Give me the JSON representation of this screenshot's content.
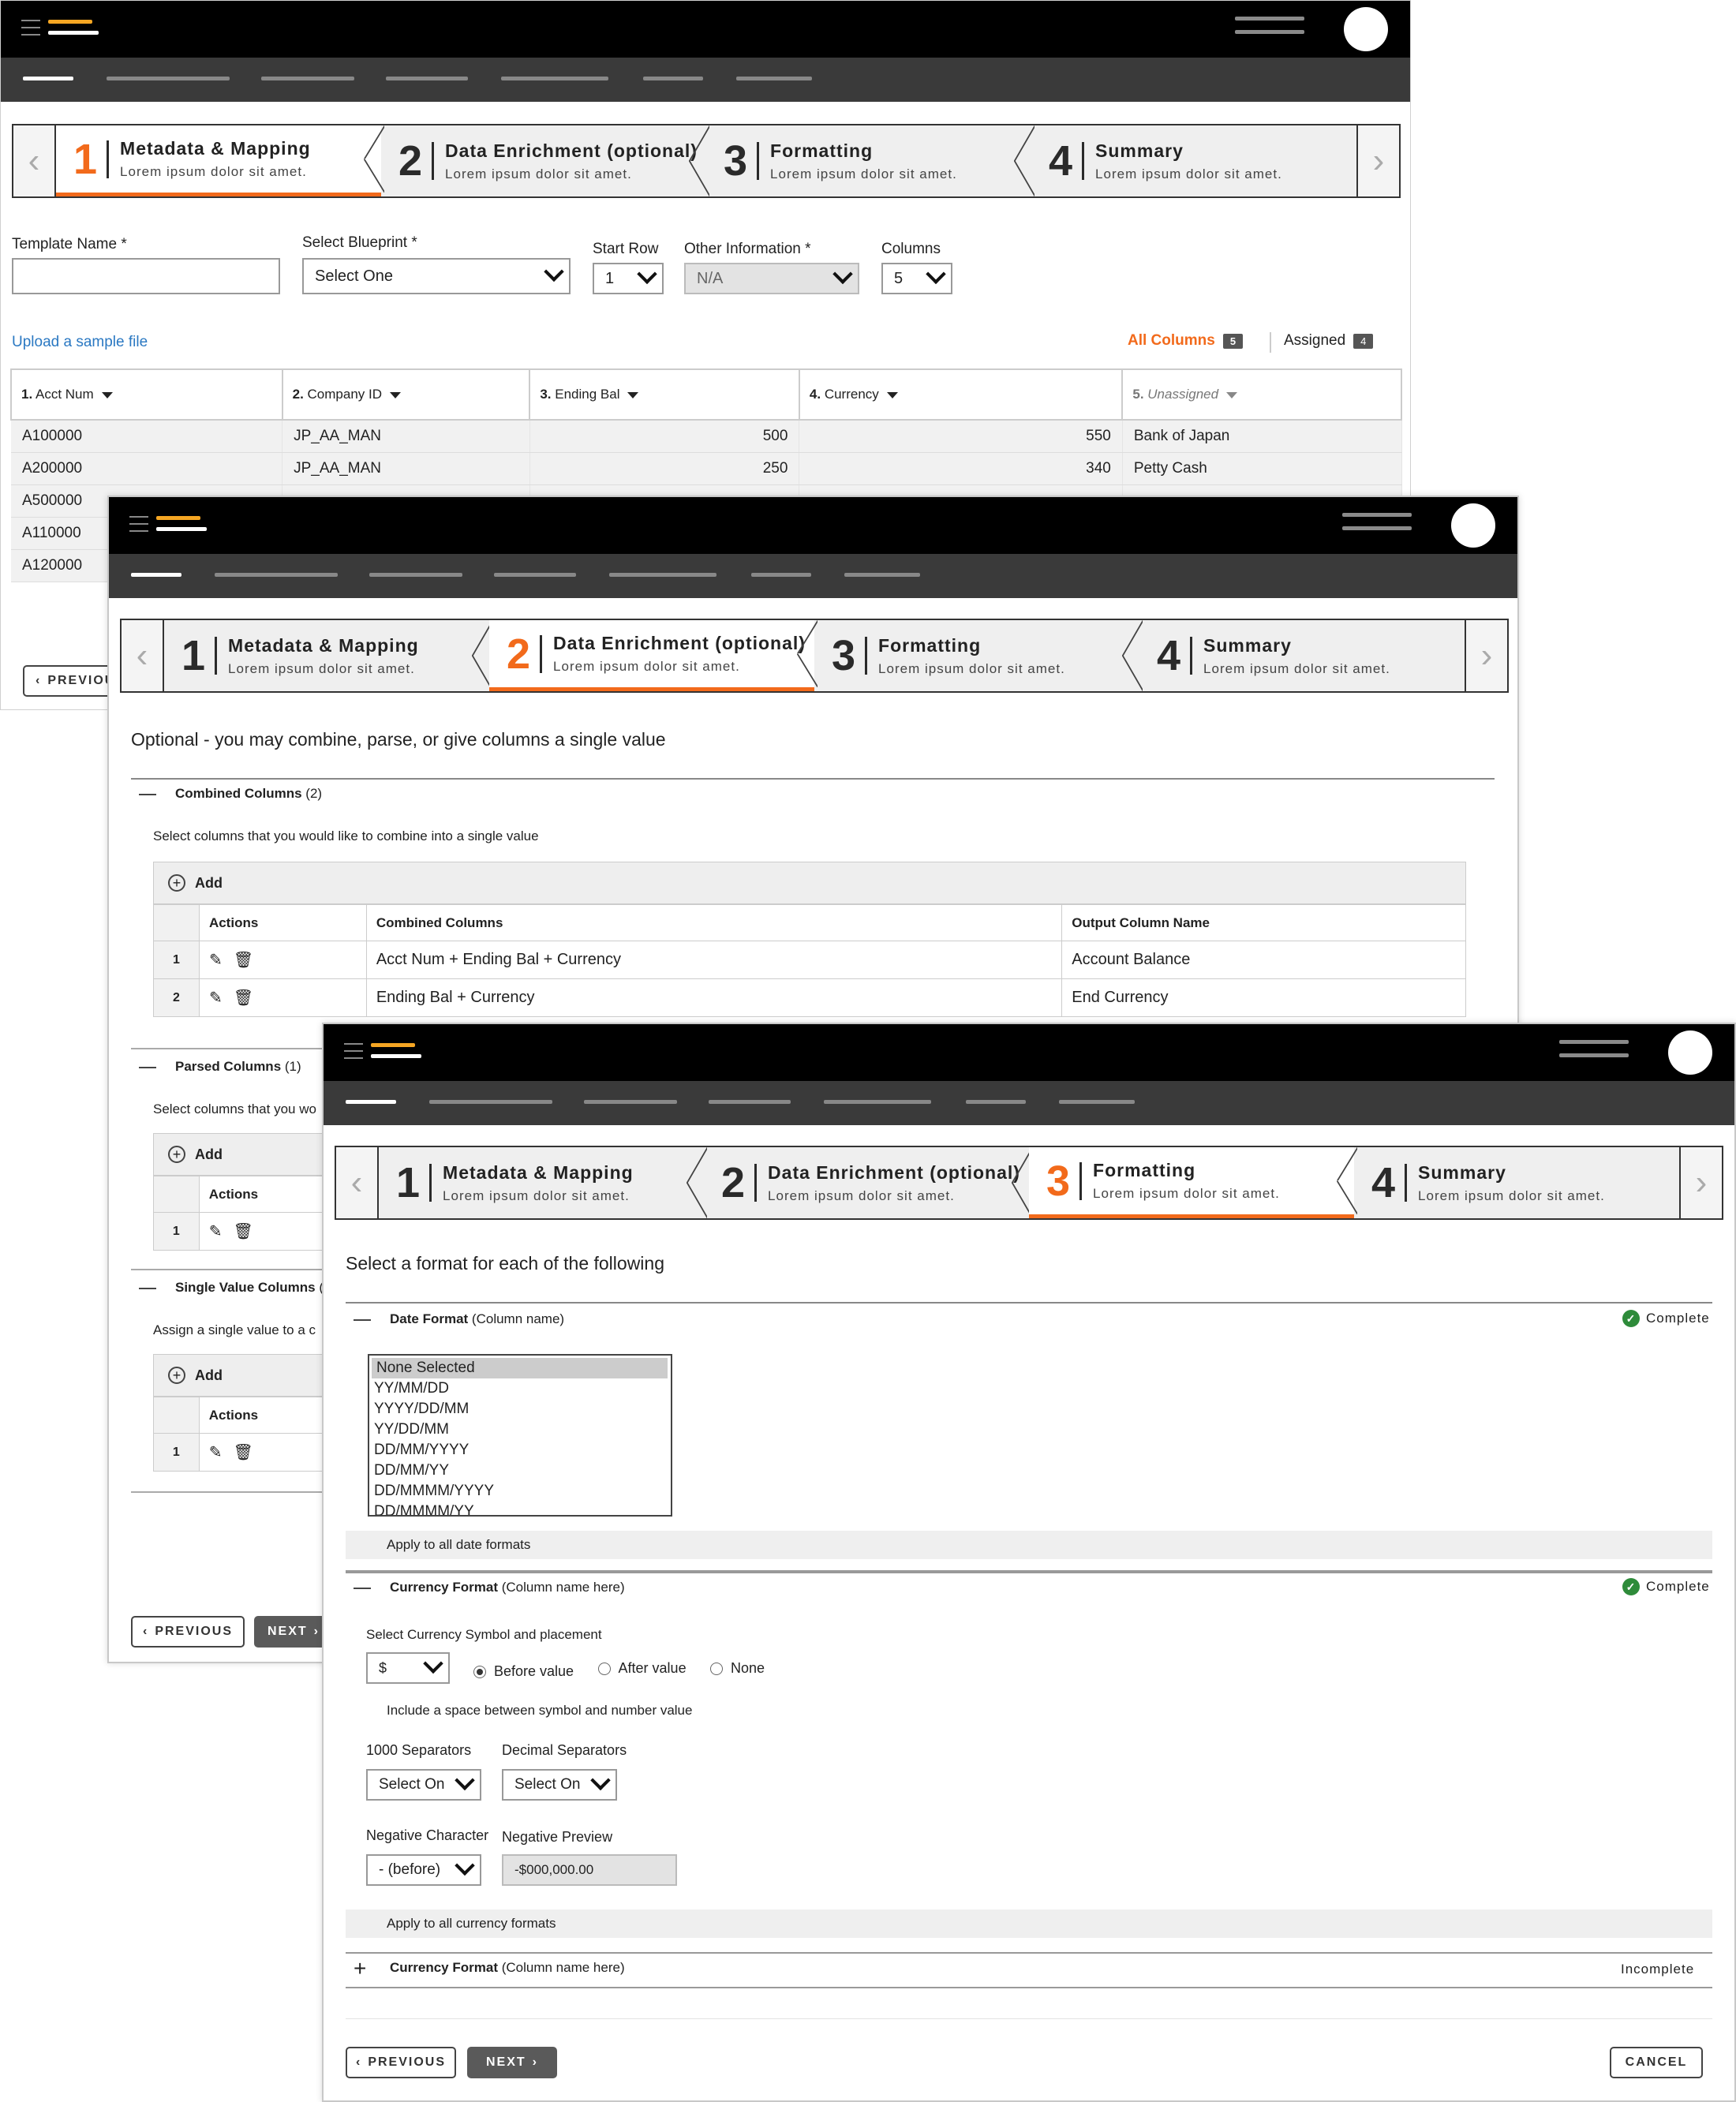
{
  "common": {
    "steps": [
      {
        "num": "1",
        "title": "Metadata & Mapping",
        "sub": "Lorem ipsum dolor sit amet."
      },
      {
        "num": "2",
        "title": "Data Enrichment (optional)",
        "sub": "Lorem ipsum dolor sit amet."
      },
      {
        "num": "3",
        "title": "Formatting",
        "sub": "Lorem ipsum dolor sit amet."
      },
      {
        "num": "4",
        "title": "Summary",
        "sub": "Lorem ipsum dolor sit amet."
      }
    ],
    "prev_arrow": "‹",
    "next_arrow": "›",
    "colors": {
      "accent": "#f26a1b",
      "topbar": "#000000",
      "navbar": "#3a3a3a",
      "success": "#2e8b3a"
    }
  },
  "screen1": {
    "active_step": 1,
    "template_name_label": "Template Name *",
    "template_name_value": "",
    "blueprint_label": "Select Blueprint *",
    "blueprint_value": "Select One",
    "start_row_label": "Start Row",
    "start_row_value": "1",
    "other_info_label": "Other Information *",
    "other_info_value": "N/A",
    "columns_label": "Columns",
    "columns_value": "5",
    "upload_link": "Upload a sample file",
    "all_columns_label": "All Columns",
    "all_columns_count": "5",
    "assigned_label": "Assigned",
    "assigned_count": "4",
    "headers": [
      {
        "num": "1.",
        "name": "Acct Num"
      },
      {
        "num": "2.",
        "name": "Company ID"
      },
      {
        "num": "3.",
        "name": "Ending Bal"
      },
      {
        "num": "4.",
        "name": "Currency"
      },
      {
        "num": "5.",
        "name": "Unassigned"
      }
    ],
    "rows": [
      [
        "A100000",
        "JP_AA_MAN",
        "500",
        "550",
        "Bank of Japan"
      ],
      [
        "A200000",
        "JP_AA_MAN",
        "250",
        "340",
        "Petty Cash"
      ],
      [
        "A500000",
        "",
        "",
        "",
        ""
      ],
      [
        "A110000",
        "",
        "",
        "",
        ""
      ],
      [
        "A120000",
        "",
        "",
        "",
        ""
      ]
    ],
    "previous_label": "PREVIOU"
  },
  "screen2": {
    "active_step": 2,
    "intro": "Optional - you may combine, parse, or give columns a single value",
    "combined_title": "Combined Columns",
    "combined_count": "(2)",
    "combined_desc": "Select columns that you would like to combine into a single value",
    "add_label": "Add",
    "table_headers": {
      "actions": "Actions",
      "combined": "Combined Columns",
      "output": "Output Column Name"
    },
    "combined_rows": [
      {
        "n": "1",
        "combined": "Acct Num + Ending Bal + Currency",
        "output": "Account Balance"
      },
      {
        "n": "2",
        "combined": "Ending Bal + Currency",
        "output": "End Currency"
      }
    ],
    "parsed_title": "Parsed Columns",
    "parsed_count": "(1)",
    "parsed_desc": "Select columns that you wo",
    "parsed_row_n": "1",
    "single_title": "Single Value Columns",
    "single_count": "(",
    "single_desc": "Assign a single value to a c",
    "single_row_n": "1",
    "previous_label": "PREVIOUS",
    "next_label": "NEXT"
  },
  "screen3": {
    "active_step": 3,
    "intro": "Select a format for each of the following",
    "date_title": "Date Format",
    "date_sub": "(Column name)",
    "complete_label": "Complete",
    "date_options": [
      "None Selected",
      "YY/MM/DD",
      "YYYY/DD/MM",
      "YY/DD/MM",
      "DD/MM/YYYY",
      "DD/MM/YY",
      "DD/MMMM/YYYY",
      "DD/MMMM/YY"
    ],
    "apply_dates": "Apply to all date formats",
    "currency_title": "Currency Format",
    "currency_sub": "(Column name here)",
    "symbol_label": "Select Currency Symbol and placement",
    "symbol_value": "$",
    "radio_options": [
      "Before value",
      "After value",
      "None"
    ],
    "radio_selected": 0,
    "space_note": "Include a space between symbol and number value",
    "thousand_label": "1000 Separators",
    "thousand_value": "Select On",
    "decimal_label": "Decimal Separators",
    "decimal_value": "Select On",
    "negchar_label": "Negative Character",
    "negchar_value": "- (before)",
    "negprev_label": "Negative Preview",
    "negprev_value": "-$000,000.00",
    "apply_currency": "Apply to all currency formats",
    "currency2_title": "Currency Format",
    "currency2_sub": "(Column name here)",
    "incomplete_label": "Incomplete",
    "previous_label": "PREVIOUS",
    "next_label": "NEXT",
    "cancel_label": "CANCEL"
  }
}
